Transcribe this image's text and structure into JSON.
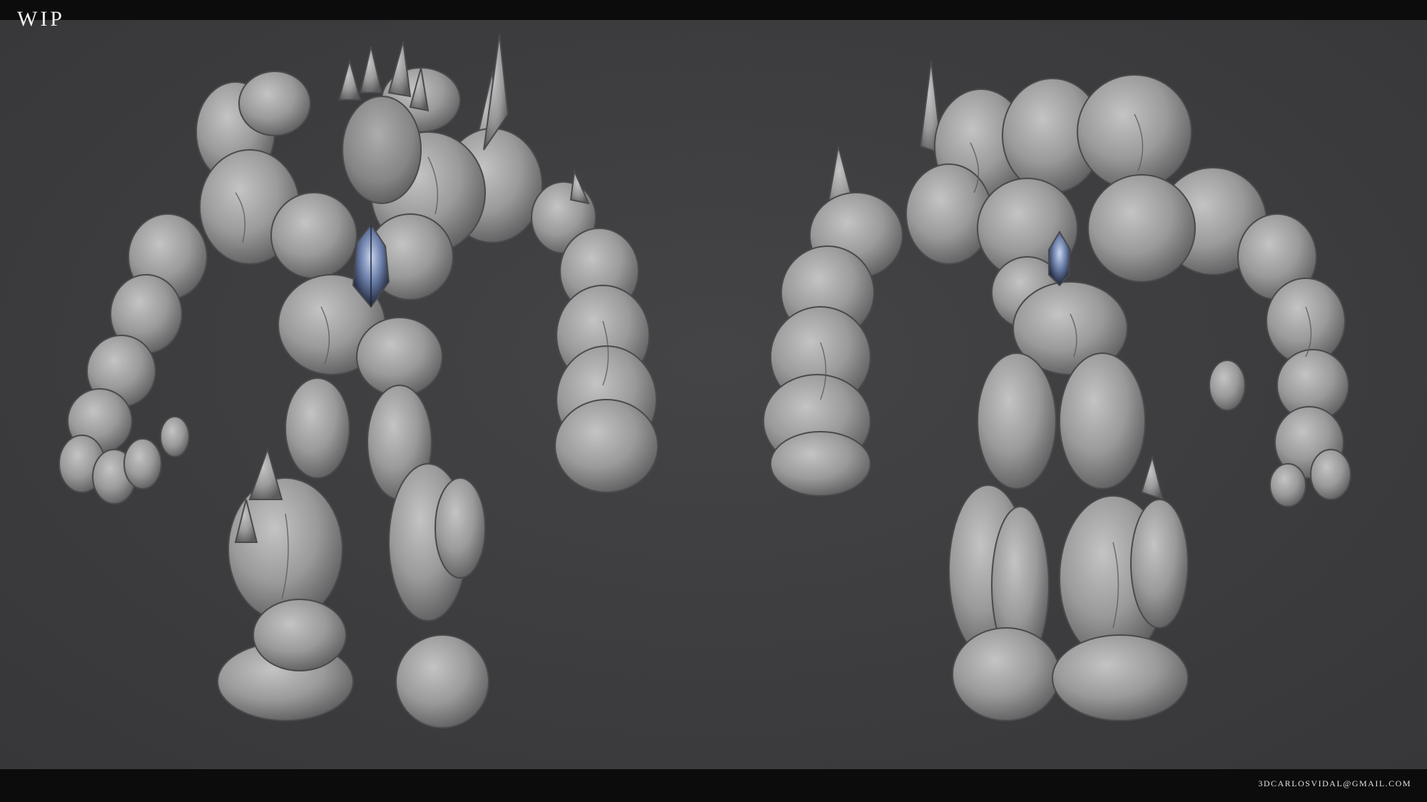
{
  "title": "WIP",
  "email": "3DCARLOSVIDAL@GMAIL.COM",
  "figures": [
    {
      "name": "golem-front-view",
      "crystal": true
    },
    {
      "name": "golem-back-view",
      "crystal": true
    }
  ],
  "colors": {
    "background": "#3d3d3f",
    "bars": "#0c0c0d",
    "stone": "#9a9a9a",
    "stone_shadow": "#4f4f51",
    "crystal": "#5a6b8c"
  }
}
